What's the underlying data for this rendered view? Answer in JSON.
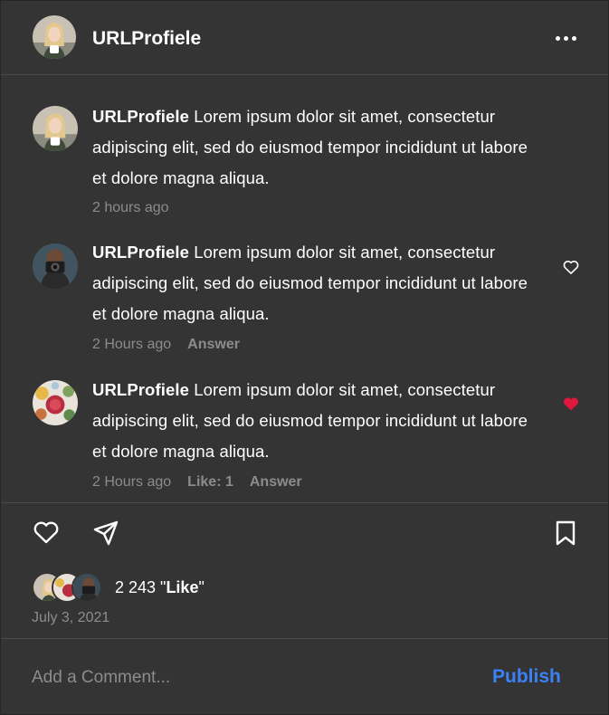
{
  "header": {
    "username": "URLProfiele",
    "menu_icon": "more-horizontal-icon"
  },
  "comments": [
    {
      "username": "URLProfiele",
      "text": "Lorem ipsum dolor sit amet, consectetur adipiscing elit, sed do eiusmod tempor incididunt ut labore et dolore magna aliqua.",
      "time": "2 hours ago",
      "avatar": "woman-blonde-avatar"
    },
    {
      "username": "URLProfiele",
      "text": "Lorem ipsum dolor sit amet, consectetur adipiscing elit, sed do eiusmod tempor incididunt ut labore et dolore magna aliqua.",
      "time": "2 Hours ago",
      "answer": "Answer",
      "liked": false,
      "avatar": "photographer-avatar"
    },
    {
      "username": "URLProfiele",
      "text": "Lorem ipsum dolor sit amet, consectetur adipiscing elit, sed do eiusmod tempor incididunt ut labore et dolore magna aliqua.",
      "time": "2 Hours ago",
      "likes": "Like: 1",
      "answer": "Answer",
      "liked": true,
      "avatar": "food-avatar"
    }
  ],
  "post": {
    "like_count": "2 243",
    "like_word": "Like",
    "date": "July 3, 2021"
  },
  "composer": {
    "placeholder": "Add a Comment...",
    "publish_label": "Publish"
  },
  "colors": {
    "background": "#343434",
    "divider": "#4a4a4a",
    "muted_text": "#8c8c8c",
    "publish_blue": "#3b82f6",
    "liked_heart": "#e0173d"
  }
}
